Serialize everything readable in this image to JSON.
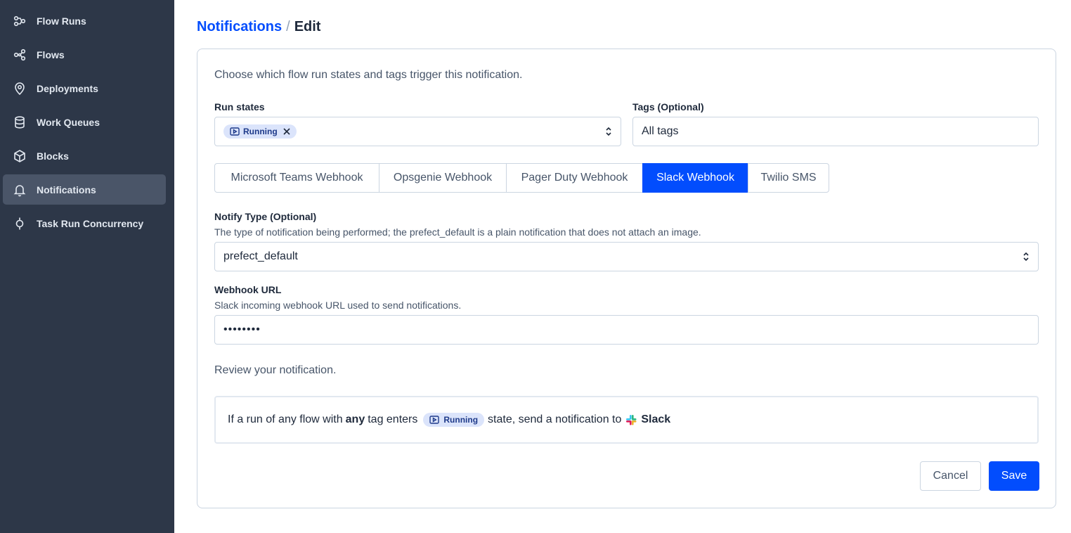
{
  "sidebar": {
    "items": [
      {
        "label": "Flow Runs",
        "icon": "flow-runs-icon",
        "active": false
      },
      {
        "label": "Flows",
        "icon": "flows-icon",
        "active": false
      },
      {
        "label": "Deployments",
        "icon": "deployments-icon",
        "active": false
      },
      {
        "label": "Work Queues",
        "icon": "work-queues-icon",
        "active": false
      },
      {
        "label": "Blocks",
        "icon": "blocks-icon",
        "active": false
      },
      {
        "label": "Notifications",
        "icon": "bell-icon",
        "active": true
      },
      {
        "label": "Task Run Concurrency",
        "icon": "task-run-concurrency-icon",
        "active": false
      }
    ]
  },
  "breadcrumb": {
    "parent": "Notifications",
    "separator": "/",
    "current": "Edit"
  },
  "form": {
    "intro": "Choose which flow run states and tags trigger this notification.",
    "run_states": {
      "label": "Run states",
      "selected": [
        "Running"
      ]
    },
    "tags": {
      "label": "Tags (Optional)",
      "placeholder": "All tags"
    },
    "block_types": {
      "options": [
        "Microsoft Teams Webhook",
        "Opsgenie Webhook",
        "Pager Duty Webhook",
        "Slack Webhook",
        "Twilio SMS"
      ],
      "selected": "Slack Webhook"
    },
    "notify_type": {
      "label": "Notify Type (Optional)",
      "description": "The type of notification being performed; the prefect_default is a plain notification that does not attach an image.",
      "value": "prefect_default"
    },
    "webhook_url": {
      "label": "Webhook URL",
      "description": "Slack incoming webhook URL used to send notifications.",
      "value": "••••••••"
    },
    "review": {
      "heading": "Review your notification.",
      "prefix": "If a run of any flow with",
      "emphasis": "any",
      "tag_text": "tag enters",
      "state": "Running",
      "middle": "state, send a notification to",
      "destination": "Slack"
    },
    "actions": {
      "cancel": "Cancel",
      "save": "Save"
    }
  },
  "colors": {
    "sidebar_bg": "#2d3748",
    "accent": "#024dfd",
    "state_pill_bg": "#dbe4fb"
  }
}
